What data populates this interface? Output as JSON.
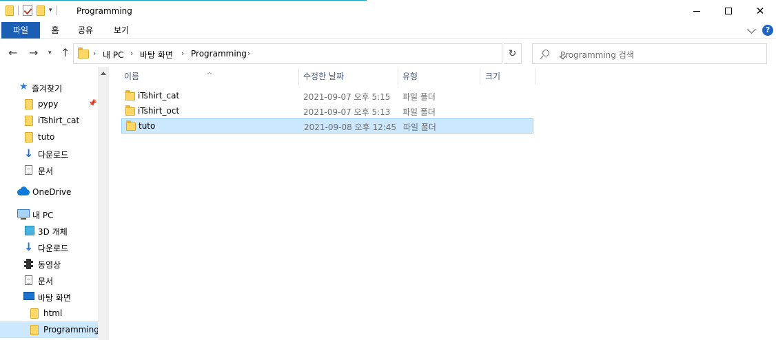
{
  "window": {
    "title": "Programming"
  },
  "ribbon": {
    "file": "파일",
    "home": "홈",
    "share": "공유",
    "view": "보기",
    "help": "?"
  },
  "address": {
    "crumbs": [
      "내 PC",
      "바탕 화면",
      "Programming"
    ]
  },
  "search": {
    "placeholder": "Programming 검색"
  },
  "nav": {
    "quick_access": "즐겨찾기",
    "quick_items": [
      "pypy",
      "iTshirt_cat",
      "tuto",
      "다운로드",
      "문서"
    ],
    "onedrive": "OneDrive",
    "this_pc": "내 PC",
    "pc_items": [
      "3D 개체",
      "다운로드",
      "동영상",
      "문서",
      "바탕 화면"
    ],
    "desktop_items": [
      "html",
      "Programming"
    ]
  },
  "columns": {
    "name": "이름",
    "modified": "수정한 날짜",
    "type": "유형",
    "size": "크기"
  },
  "files": [
    {
      "name": "iTshirt_cat",
      "modified": "2021-09-07 오후 5:15",
      "type": "파일 폴더"
    },
    {
      "name": "iTshirt_oct",
      "modified": "2021-09-07 오후 5:13",
      "type": "파일 폴더"
    },
    {
      "name": "tuto",
      "modified": "2021-09-08 오후 12:45",
      "type": "파일 폴더"
    }
  ],
  "colors": {
    "accent": "#1a5fb4",
    "selection": "#cce8ff",
    "folder": "#ffd767"
  }
}
